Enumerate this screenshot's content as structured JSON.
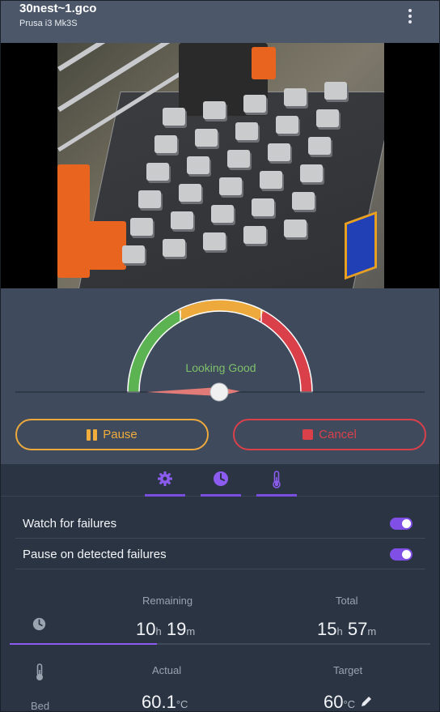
{
  "header": {
    "title": "30nest~1.gco",
    "subtitle": "Prusa i3 Mk3S",
    "menu_icon": "more-vertical-icon"
  },
  "camera": {
    "description_icon": "camera-feed"
  },
  "gauge": {
    "status_text": "Looking Good",
    "status_color": "#7fc06a",
    "level": 0.08,
    "zones": [
      {
        "name": "good",
        "color": "#5bb351"
      },
      {
        "name": "warn",
        "color": "#eea93c"
      },
      {
        "name": "bad",
        "color": "#d9404a"
      }
    ]
  },
  "actions": {
    "pause_label": "Pause",
    "cancel_label": "Cancel"
  },
  "tabs": [
    {
      "icon": "gear-icon"
    },
    {
      "icon": "clock-icon"
    },
    {
      "icon": "thermometer-icon"
    }
  ],
  "settings": {
    "watch_label": "Watch for failures",
    "watch_on": true,
    "pause_label": "Pause on detected failures",
    "pause_on": true
  },
  "time": {
    "remaining_label": "Remaining",
    "total_label": "Total",
    "remaining_h": "10",
    "remaining_m": "19",
    "total_h": "15",
    "total_m": "57",
    "unit_h": "h",
    "unit_m": "m",
    "progress": 0.35
  },
  "temps": {
    "actual_label": "Actual",
    "target_label": "Target",
    "bed_label": "Bed",
    "bed_actual": "60.1",
    "bed_target": "60",
    "unit": "°C"
  },
  "colors": {
    "accent": "#7f4fe6",
    "pause": "#eea93c",
    "cancel": "#d9404a"
  }
}
